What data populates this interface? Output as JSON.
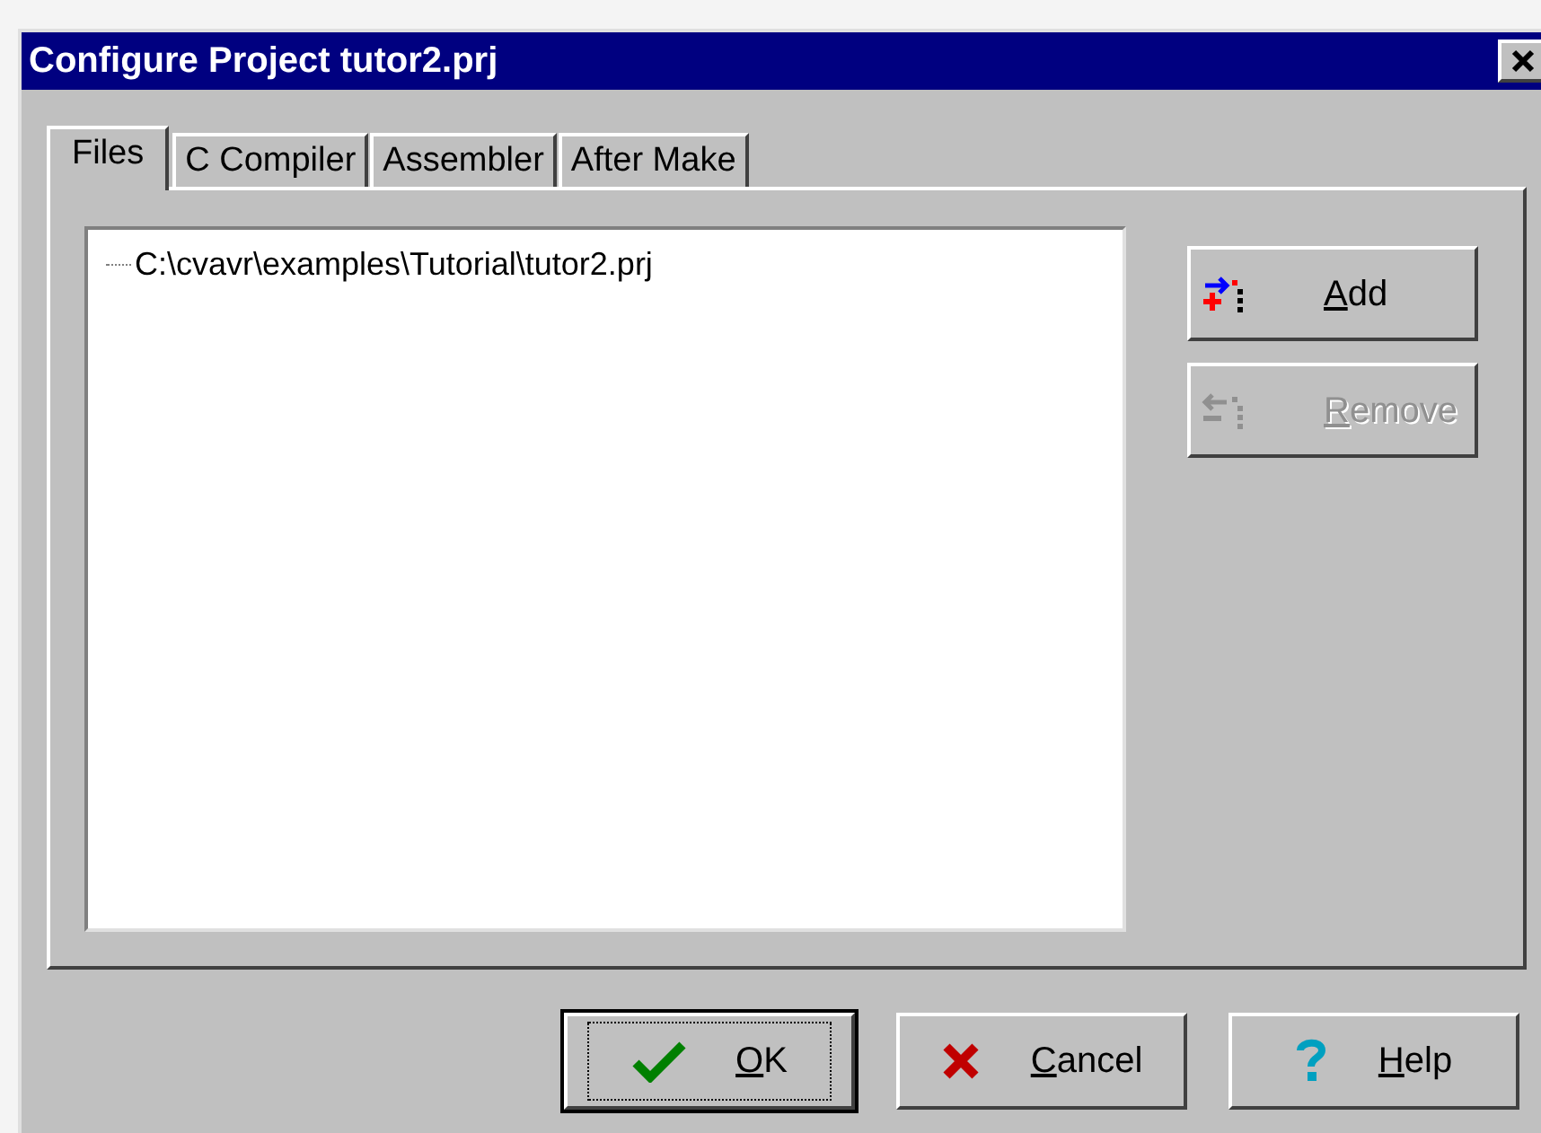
{
  "window": {
    "title": "Configure Project tutor2.prj"
  },
  "tabs": [
    {
      "label": "Files",
      "selected": true
    },
    {
      "label": "C Compiler",
      "selected": false
    },
    {
      "label": "Assembler",
      "selected": false
    },
    {
      "label": "After Make",
      "selected": false
    }
  ],
  "file_tree": {
    "items": [
      {
        "label": "C:\\cvavr\\examples\\Tutorial\\tutor2.prj"
      }
    ]
  },
  "side_buttons": [
    {
      "kind": "add",
      "label": "Add",
      "disabled": false
    },
    {
      "kind": "remove",
      "label": "Remove",
      "disabled": true
    }
  ],
  "buttons": [
    {
      "kind": "ok",
      "label": "OK",
      "default": true
    },
    {
      "kind": "cancel",
      "label": "Cancel",
      "default": false
    },
    {
      "kind": "help",
      "label": "Help",
      "default": false
    }
  ]
}
